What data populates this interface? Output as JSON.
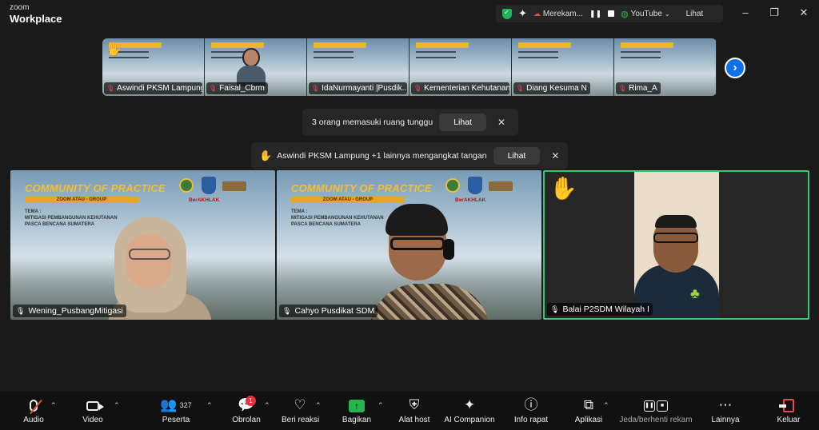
{
  "app": {
    "brand_small": "zoom",
    "brand_name": "Workplace"
  },
  "status": {
    "recording_label": "Merekam...",
    "stream_label": "YouTube",
    "view_label": "Lihat"
  },
  "window_controls": [
    "–",
    "❐",
    "✕"
  ],
  "strip": {
    "thumbnails": [
      {
        "name": "Aswindi  PKSM Lampung",
        "raised_hand": true
      },
      {
        "name": "Faisal_Cbrm",
        "has_person": true
      },
      {
        "name": "IdaNurmayanti |Pusdik..."
      },
      {
        "name": "Kementerian Kehutanan"
      },
      {
        "name": "Diang Kesuma N"
      },
      {
        "name": "Rima_A"
      }
    ],
    "next_icon": "chevron-right-icon"
  },
  "toasts": {
    "waiting_room": {
      "text": "3 orang memasuki ruang tunggu",
      "button": "Lihat"
    },
    "raise_hand": {
      "text": "Aswindi  PKSM Lampung +1 lainnya mengangkat tangan",
      "button": "Lihat"
    }
  },
  "tiles": {
    "slide": {
      "title": "COMMUNITY OF PRACTICE",
      "subtitle": "ZOOM ATAU - GROUP",
      "tema_label": "TEMA :",
      "tema_line1": "MITIGASI PEMBANGUNAN KEHUTANAN",
      "tema_line2": "PASCA BENCANA SUMATERA",
      "logo_text": "BerAKHLAK"
    },
    "names": [
      "Wening_PusbangMitigasi",
      "Cahyo Pusdikat SDM",
      "Balai P2SDM Wilayah I"
    ]
  },
  "toolbar": {
    "audio": "Audio",
    "video": "Video",
    "participants": "Peserta",
    "participant_count": "327",
    "chat": "Obrolan",
    "chat_badge": "1",
    "reactions": "Beri reaksi",
    "share": "Bagikan",
    "host_tools": "Alat host",
    "ai_companion": "AI Companion",
    "meeting_info": "Info rapat",
    "apps": "Aplikasi",
    "recording": "Jeda/berhenti rekam",
    "more": "Lainnya",
    "leave": "Keluar"
  },
  "colors": {
    "accent_blue": "#0e71eb",
    "active_speaker": "#37c871",
    "share_green": "#27b34d",
    "danger": "#e14b4b"
  }
}
